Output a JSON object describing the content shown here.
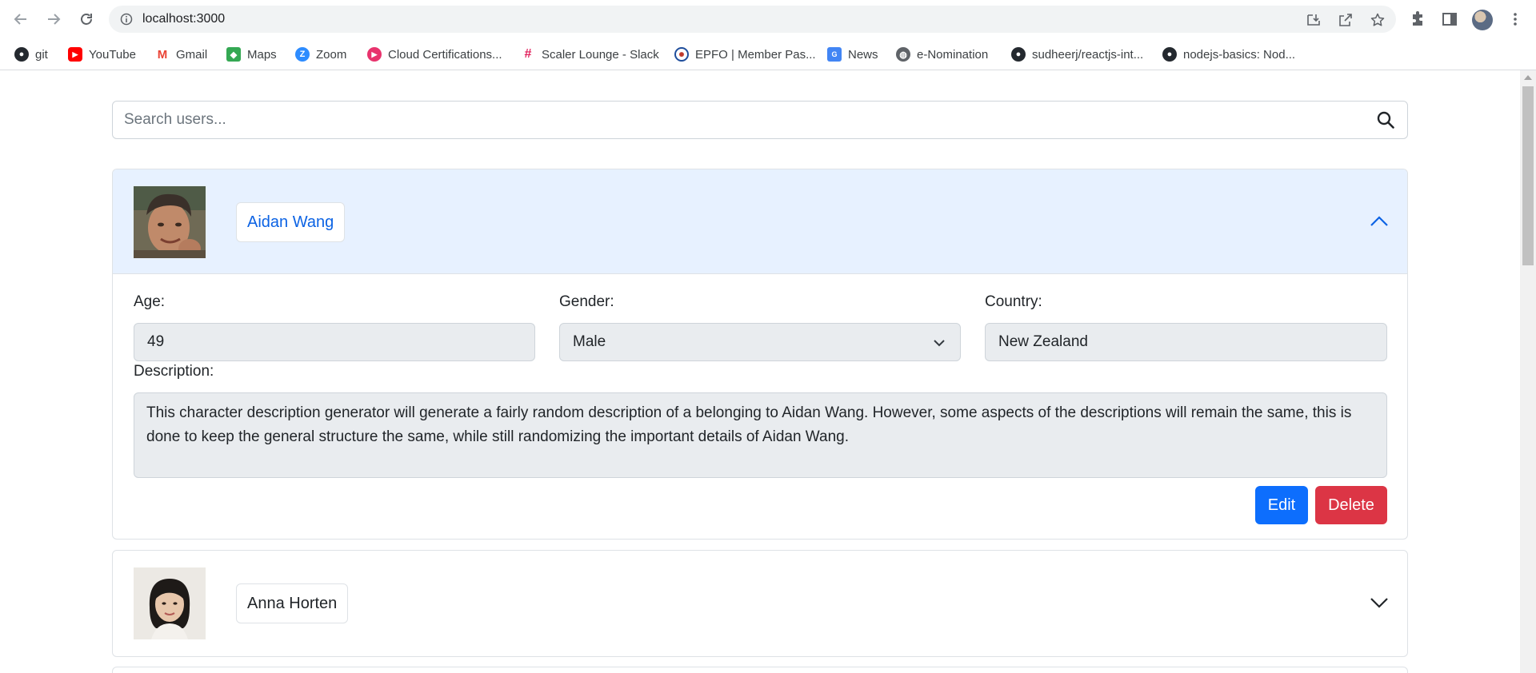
{
  "browser": {
    "url": "localhost:3000",
    "bookmarks": [
      {
        "label": "git",
        "icon": "github-icon"
      },
      {
        "label": "YouTube",
        "icon": "youtube-icon"
      },
      {
        "label": "Gmail",
        "icon": "gmail-icon"
      },
      {
        "label": "Maps",
        "icon": "maps-icon"
      },
      {
        "label": "Zoom",
        "icon": "zoom-icon"
      },
      {
        "label": "Cloud Certifications...",
        "icon": "play-icon"
      },
      {
        "label": "Scaler Lounge - Slack",
        "icon": "slack-icon"
      },
      {
        "label": "EPFO | Member Pas...",
        "icon": "epfo-icon"
      },
      {
        "label": "News",
        "icon": "news-icon"
      },
      {
        "label": "e-Nomination",
        "icon": "globe-icon"
      },
      {
        "label": "sudheerj/reactjs-int...",
        "icon": "github-icon"
      },
      {
        "label": "nodejs-basics: Nod...",
        "icon": "github-icon"
      }
    ]
  },
  "search": {
    "placeholder": "Search users...",
    "value": ""
  },
  "users": [
    {
      "name": "Aidan Wang",
      "expanded": true,
      "age_label": "Age:",
      "age": "49",
      "gender_label": "Gender:",
      "gender": "Male",
      "country_label": "Country:",
      "country": "New Zealand",
      "description_label": "Description:",
      "description": "This character description generator will generate a fairly random description of a belonging to Aidan Wang. However, some aspects of the descriptions will remain the same, this is done to keep the general structure the same, while still randomizing the important details of Aidan Wang.",
      "edit_label": "Edit",
      "delete_label": "Delete"
    },
    {
      "name": "Anna Horten",
      "expanded": false
    }
  ],
  "colors": {
    "primary": "#0d6efd",
    "danger": "#dc3545",
    "header_active": "#e7f1ff",
    "input_disabled": "#e9ecef"
  }
}
